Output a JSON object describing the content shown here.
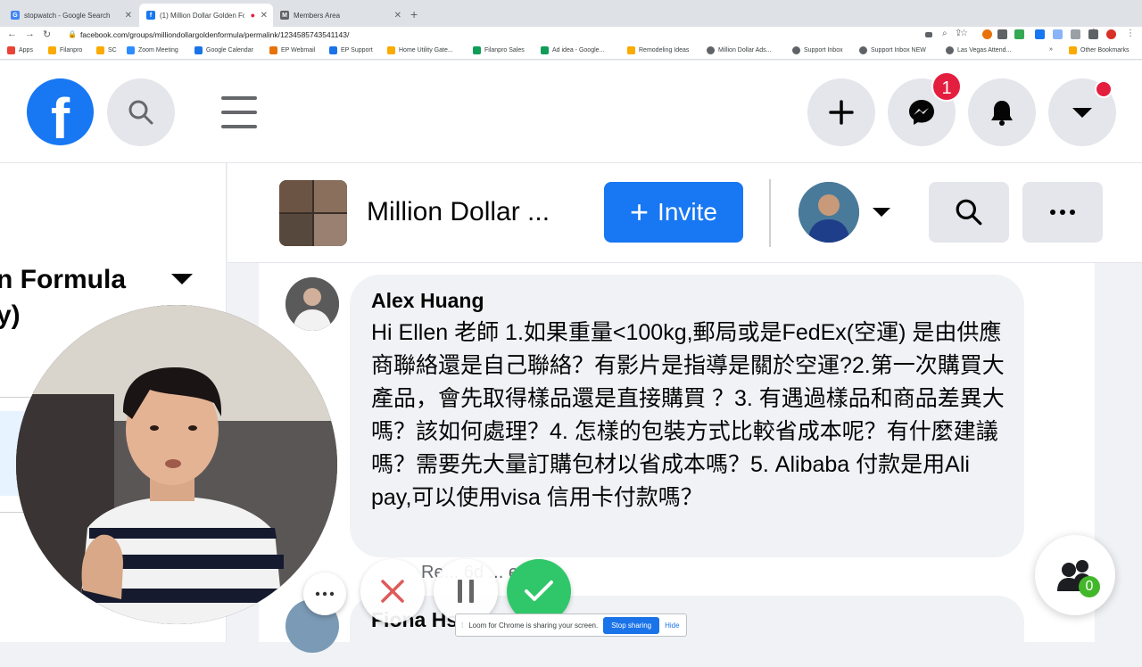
{
  "browser": {
    "tabs": [
      {
        "title": "stopwatch - Google Search",
        "favicon": "G",
        "color": "#4285f4",
        "active": false
      },
      {
        "title": "(1) Million Dollar Golden Fo...",
        "favicon": "f",
        "color": "#1877f2",
        "active": true
      },
      {
        "title": "Members Area",
        "favicon": "M",
        "color": "#5f6368",
        "active": false
      }
    ],
    "new_tab": "+",
    "url": "facebook.com/groups/milliondollargoldenformula/permalink/1234585743541143/",
    "bookmarks": [
      {
        "label": "Apps",
        "color": "#ea4335"
      },
      {
        "label": "Filanpro",
        "color": "#f9ab00"
      },
      {
        "label": "SC",
        "color": "#f9ab00"
      },
      {
        "label": "Zoom Meeting",
        "color": "#2d8cff"
      },
      {
        "label": "Google Calendar",
        "color": "#1a73e8"
      },
      {
        "label": "EP Webmail",
        "color": "#e8710a"
      },
      {
        "label": "EP Support",
        "color": "#1a73e8"
      },
      {
        "label": "Home Utility Gate...",
        "color": "#f9ab00"
      },
      {
        "label": "Filanpro Sales",
        "color": "#0f9d58"
      },
      {
        "label": "Ad idea - Google...",
        "color": "#0f9d58"
      },
      {
        "label": "Remodeling Ideas",
        "color": "#f9ab00"
      },
      {
        "label": "Million Dollar Ads...",
        "color": "#5f6368"
      },
      {
        "label": "Support Inbox",
        "color": "#5f6368"
      },
      {
        "label": "Support Inbox NEW",
        "color": "#5f6368"
      },
      {
        "label": "Las Vegas Attend...",
        "color": "#5f6368"
      },
      {
        "label": "Other Bookmarks",
        "color": "#f9ab00"
      }
    ],
    "bookmarks_overflow": "»"
  },
  "header": {
    "logo": "f",
    "messenger_badge": "1"
  },
  "sidebar": {
    "group_name_line1": "n Formula",
    "group_name_line2": "y)"
  },
  "group": {
    "title": "Million Dollar ...",
    "invite_label": "Invite"
  },
  "comments": [
    {
      "author": "Alex Huang",
      "text": "Hi Ellen 老師 1.如果重量<100kg,郵局或是FedEx(空運) 是由供應商聯絡還是自己聯絡？有影片是指導是關於空運?2.第一次購買大產品，會先取得樣品還是直接購買 ？3. 有遇過樣品和商品差異大嗎？該如何處理？4. 怎樣的包裝方式比較省成本呢？有什麼建議嗎？需要先大量訂購包材以省成本嗎？5. Alibaba 付款是用Ali pay,可以使用visa 信用卡付款嗎？",
      "meta": "Re... 6d ... ed"
    },
    {
      "author": "Fiona Hs..."
    }
  ],
  "loom": {
    "sharing_text": "Loom for Chrome is sharing your screen.",
    "stop_label": "Stop sharing",
    "hide_label": "Hide"
  },
  "people": {
    "count": "0"
  },
  "colors": {
    "facebook_blue": "#1877f2",
    "notification_red": "#e41e3f",
    "loom_green": "#2fc769"
  }
}
